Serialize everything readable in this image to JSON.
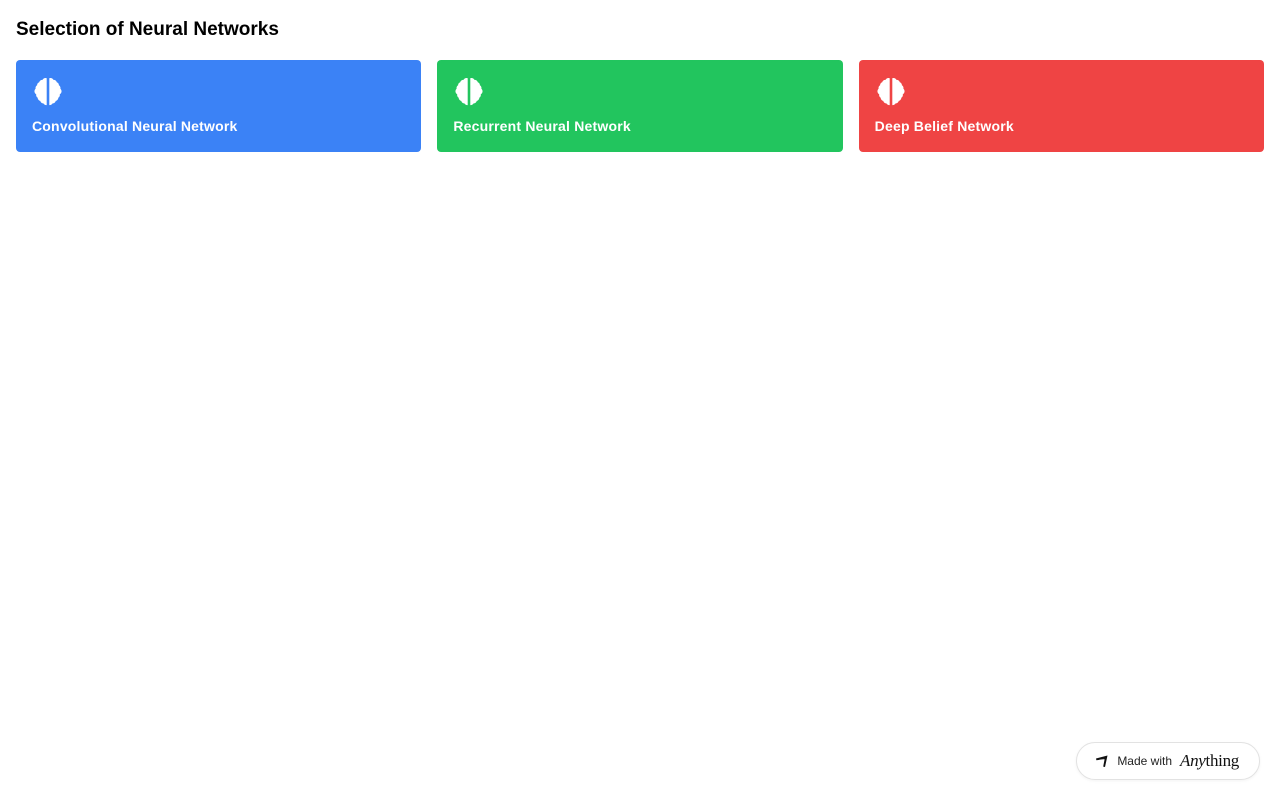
{
  "page": {
    "title": "Selection of Neural Networks"
  },
  "cards": [
    {
      "label": "Convolutional Neural Network",
      "color": "#3b82f6",
      "icon": "brain-icon"
    },
    {
      "label": "Recurrent Neural Network",
      "color": "#22c55e",
      "icon": "brain-icon"
    },
    {
      "label": "Deep Belief Network",
      "color": "#ef4444",
      "icon": "brain-icon"
    }
  ],
  "badge": {
    "made_with": "Made with",
    "brand_italic": "Any",
    "brand_rest": "thing",
    "icon": "anything-logo-icon"
  }
}
